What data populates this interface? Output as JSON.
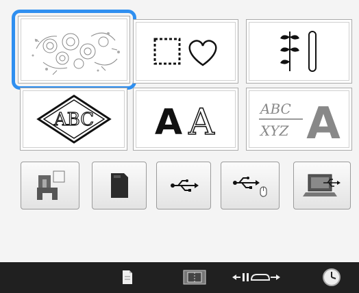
{
  "grid": {
    "tiles": [
      {
        "name": "floral-embroidery-tile",
        "icon": "floral-pattern-icon",
        "selected": true
      },
      {
        "name": "frame-shapes-tile",
        "icon": "square-heart-frame-icon"
      },
      {
        "name": "utility-stitches-tile",
        "icon": "leaf-stitch-icon"
      },
      {
        "name": "monogram-tile",
        "icon": "monogram-diamond-icon",
        "label": "ABC"
      },
      {
        "name": "alphabet-fonts-tile",
        "icon": "font-letters-icon",
        "label": "AA"
      },
      {
        "name": "decorative-alphabet-tile",
        "icon": "decorative-letters-icon",
        "label": "A"
      }
    ]
  },
  "memory_row": {
    "buttons": [
      {
        "name": "machine-memory-button",
        "icon": "embroidery-machine-icon"
      },
      {
        "name": "sd-card-button",
        "icon": "sd-card-icon"
      },
      {
        "name": "usb-button",
        "icon": "usb-icon"
      },
      {
        "name": "usb-mouse-button",
        "icon": "usb-mouse-icon"
      },
      {
        "name": "computer-usb-button",
        "icon": "computer-usb-icon"
      }
    ]
  },
  "bottom_bar": {
    "items": [
      {
        "name": "document-icon"
      },
      {
        "name": "hoop-icon"
      },
      {
        "name": "needle-position-icon"
      },
      {
        "name": "clock-icon"
      }
    ]
  },
  "colors": {
    "selection": "#2f8ff0",
    "tile_border": "#a9a9a9",
    "bottom_bar": "#202020"
  }
}
